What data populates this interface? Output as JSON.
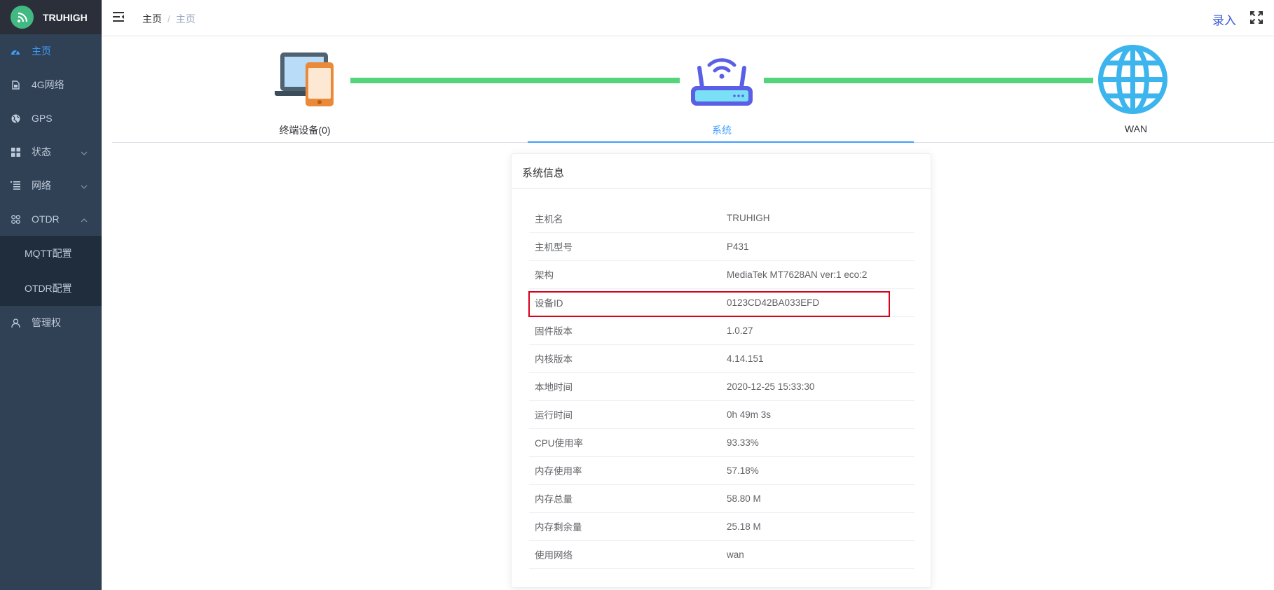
{
  "brand": {
    "name": "TRUHIGH",
    "accent": "#42b983"
  },
  "sidebar": {
    "items": [
      {
        "label": "主页",
        "icon": "dashboard-icon",
        "active": true
      },
      {
        "label": "4G网络",
        "icon": "sim-card-icon"
      },
      {
        "label": "GPS",
        "icon": "globe-icon"
      },
      {
        "label": "状态",
        "icon": "grid-icon",
        "expandable": true
      },
      {
        "label": "网络",
        "icon": "list-icon",
        "expandable": true
      },
      {
        "label": "OTDR",
        "icon": "apps-icon",
        "expanded": true,
        "children": [
          {
            "label": "MQTT配置"
          },
          {
            "label": "OTDR配置"
          }
        ]
      },
      {
        "label": "管理权",
        "icon": "user-icon"
      }
    ]
  },
  "header": {
    "breadcrumb": [
      "主页",
      "主页"
    ],
    "login_label": "录入"
  },
  "topology": {
    "nodes": [
      {
        "label": "终端设备(0)",
        "icon": "laptop-phone-icon"
      },
      {
        "label": "系统",
        "icon": "router-icon",
        "active": true
      },
      {
        "label": "WAN",
        "icon": "globe-icon"
      }
    ],
    "link_color": "#55d57b"
  },
  "system_info": {
    "title": "系统信息",
    "rows": [
      {
        "key": "主机名",
        "value": "TRUHIGH"
      },
      {
        "key": "主机型号",
        "value": "P431"
      },
      {
        "key": "架构",
        "value": "MediaTek MT7628AN ver:1 eco:2"
      },
      {
        "key": "设备ID",
        "value": "0123CD42BA033EFD",
        "highlighted": true
      },
      {
        "key": "固件版本",
        "value": "1.0.27"
      },
      {
        "key": "内核版本",
        "value": "4.14.151"
      },
      {
        "key": "本地时间",
        "value": "2020-12-25 15:33:30"
      },
      {
        "key": "运行时间",
        "value": "0h 49m 3s"
      },
      {
        "key": "CPU使用率",
        "value": "93.33%"
      },
      {
        "key": "内存使用率",
        "value": "57.18%"
      },
      {
        "key": "内存总量",
        "value": "58.80 M"
      },
      {
        "key": "内存剩余量",
        "value": "25.18 M"
      },
      {
        "key": "使用网络",
        "value": "wan"
      }
    ]
  }
}
